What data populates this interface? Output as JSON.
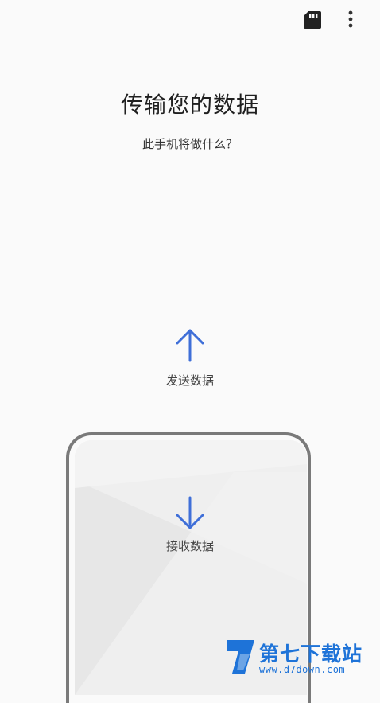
{
  "header": {
    "sd_card_icon": "sd-card-icon",
    "more_icon": "more-vertical-icon"
  },
  "main": {
    "title": "传输您的数据",
    "subtitle": "此手机将做什么？"
  },
  "options": {
    "send": {
      "label": "发送数据",
      "icon": "arrow-up-icon"
    },
    "receive": {
      "label": "接收数据",
      "icon": "arrow-down-icon"
    }
  },
  "watermark": {
    "title": "第七下载站",
    "url": "www.d7down.com"
  },
  "colors": {
    "accent": "#3f6fd8",
    "background": "#fafafa",
    "phone_frame": "#7a7a7a",
    "watermark": "#1e73d8"
  }
}
